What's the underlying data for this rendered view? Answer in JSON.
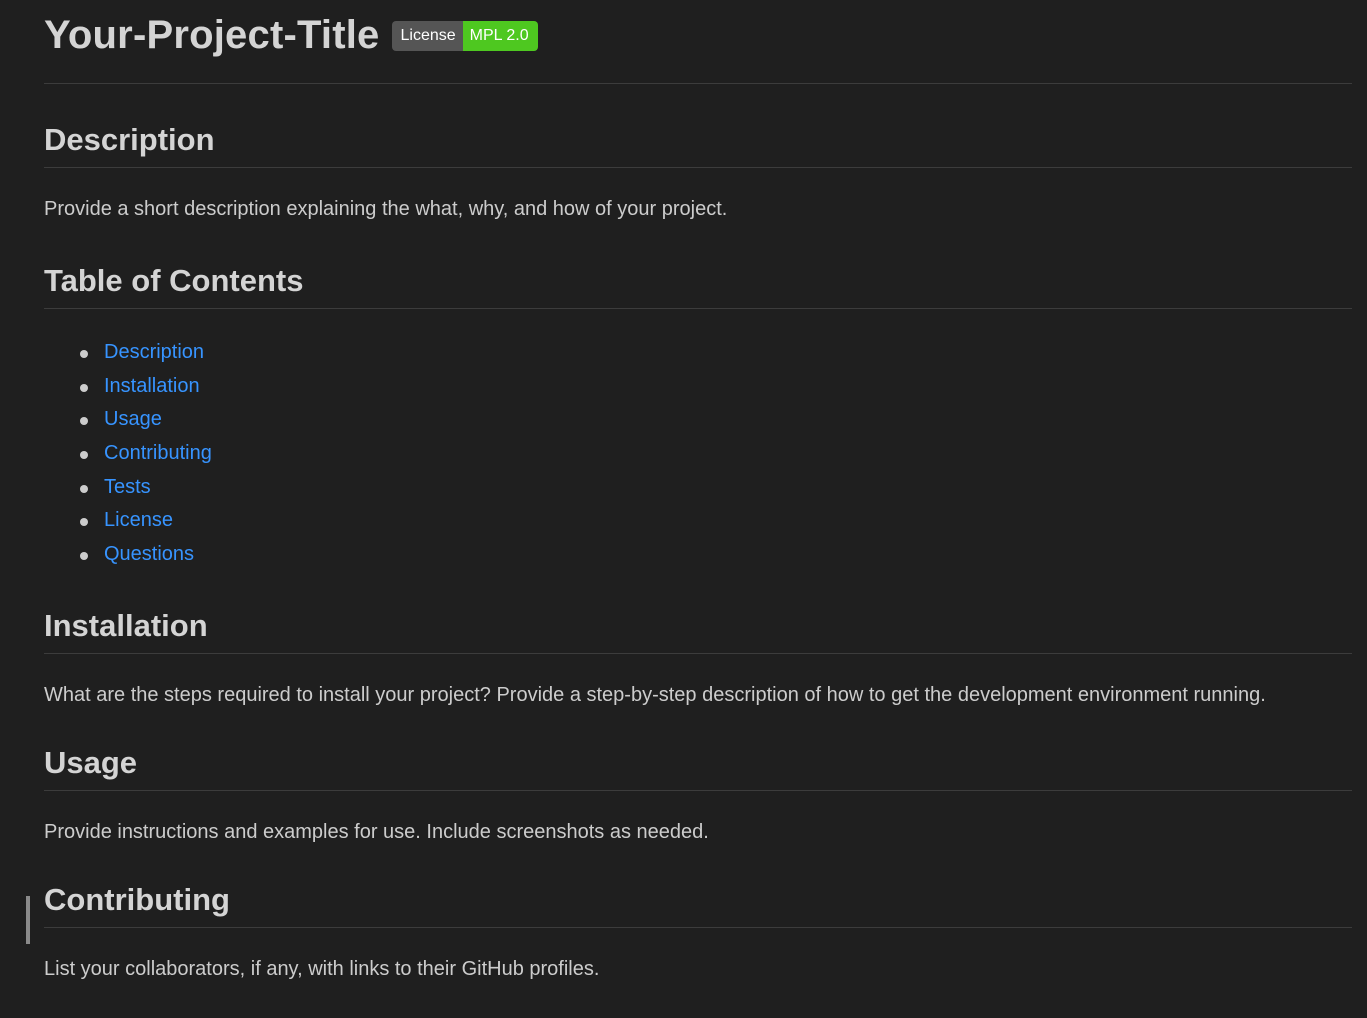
{
  "title": "Your-Project-Title",
  "badge": {
    "label": "License",
    "value": "MPL 2.0",
    "label_color": "#555555",
    "value_color": "#4ec820"
  },
  "sections": {
    "description": {
      "heading": "Description",
      "text": "Provide a short description explaining the what, why, and how of your project."
    },
    "toc": {
      "heading": "Table of Contents",
      "items": [
        "Description",
        "Installation",
        "Usage",
        "Contributing",
        "Tests",
        "License",
        "Questions"
      ]
    },
    "installation": {
      "heading": "Installation",
      "text": "What are the steps required to install your project? Provide a step-by-step description of how to get the development environment running."
    },
    "usage": {
      "heading": "Usage",
      "text": "Provide instructions and examples for use. Include screenshots as needed."
    },
    "contributing": {
      "heading": "Contributing",
      "text": "List your collaborators, if any, with links to their GitHub profiles."
    }
  },
  "colors": {
    "background": "#1f1f1f",
    "link": "#3794ff",
    "text": "#cccccc",
    "heading": "#d4d4d4"
  }
}
